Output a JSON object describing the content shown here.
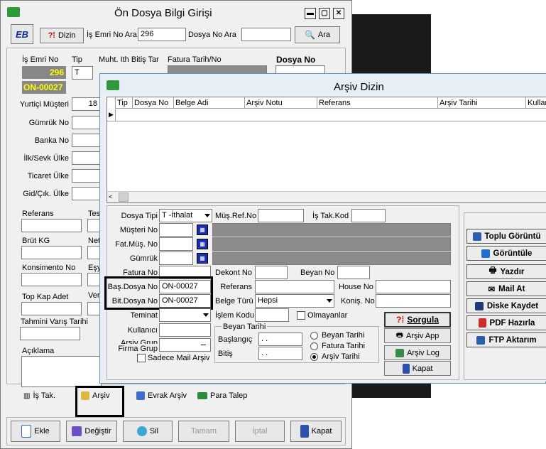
{
  "back_window": {
    "title": "Ön Dosya Bilgi Girişi",
    "dizin_label": "Dizin",
    "is_emri_no_ara_label": "İş Emri No Ara",
    "is_emri_no_ara_value": "296",
    "dosya_no_ara_label": "Dosya No Ara",
    "dosya_no_ara_value": "",
    "ara_label": "Ara",
    "col_is_emri_no": "İş Emri No",
    "col_tip": "Tip",
    "col_muht": "Muht. Ith Bitiş Tar",
    "col_fatura": "Fatura Tarih/No",
    "col_dosya_no": "Dosya No",
    "is_emri_no_value": "296",
    "tip_value": "T",
    "dosya_code": "ON-00027",
    "yurtici_label": "Yurtiçi Müşteri",
    "yurtici_value": "18",
    "gumruk_label": "Gümrük No",
    "banka_label": "Banka No",
    "ilk_sevk_label": "İlk/Sevk Ülke",
    "ticaret_label": "Ticaret Ülke",
    "gid_cik_label": "Gid/Çık. Ülke",
    "referans_label": "Referans",
    "tes_label": "Tes",
    "brut_label": "Brüt KG",
    "net_label": "Net",
    "konsimento_label": "Konsimento No",
    "esya_label": "Eşy",
    "top_kap_label": "Top Kap Adet",
    "ver_label": "Ver",
    "tahmini_label": "Tahmini Varış Tarihi",
    "aciklama_label": "Açıklama",
    "tab_is_tak": "İş Tak.",
    "tab_arsiv": "Arşiv",
    "tab_evrak": "Evrak Arşiv",
    "tab_para": "Para Talep",
    "btn_ekle": "Ekle",
    "btn_degistir": "Değiştir",
    "btn_sil": "Sil",
    "btn_tamam": "Tamam",
    "btn_iptal": "İptal",
    "btn_kapat": "Kapat"
  },
  "front_window": {
    "title": "Arşiv Dizin",
    "grid_columns": [
      "Tip",
      "Dosya No",
      "Belge Adi",
      "Arşiv Notu",
      "Referans",
      "Arşiv Tarihi",
      "Kullan"
    ],
    "dosya_tipi_label": "Dosya Tipi",
    "dosya_tipi_value": "T -İthalat",
    "mus_ref_label": "Müş.Ref.No",
    "is_tak_kod_label": "İş Tak.Kod",
    "musteri_no_label": "Müşteri No",
    "fat_mus_no_label": "Fat.Müş. No",
    "gumruk_label": "Gümrük",
    "fatura_no_label": "Fatura No",
    "dekont_no_label": "Dekont No",
    "beyan_no_label": "Beyan No",
    "bas_dosya_label": "Baş.Dosya No",
    "bas_dosya_value": "ON-00027",
    "bit_dosya_label": "Bit.Dosya No",
    "bit_dosya_value": "ON-00027",
    "referans_label": "Referans",
    "house_no_label": "House No",
    "belge_turu_label": "Belge Türü",
    "belge_turu_value": "Hepsi",
    "konis_no_label": "Koniş. No",
    "teminat_label": "Teminat",
    "islem_kodu_label": "İşlem Kodu",
    "olmayanlar_label": "Olmayanlar",
    "kullanici_label": "Kullanıcı",
    "arsiv_grup_label": "Arşiv Grup",
    "firma_grup_label": "Firma Grup",
    "sadece_mail_label": "Sadece Mail Arşiv",
    "beyan_tarihi_label": "Beyan Tarihi",
    "baslangic_label": "Başlangıç",
    "bitis_label": "Bitiş",
    "date_placeholder": " .  .",
    "radio_beyan": "Beyan Tarihi",
    "radio_fatura": "Fatura Tarihi",
    "radio_arsiv": "Arşiv Tarihi",
    "btn_sorgula": "Sorgula",
    "btn_arsiv_app": "Arşiv App",
    "btn_arsiv_log": "Arşiv Log",
    "btn_kapat": "Kapat",
    "btn_toplu": "Toplu Görüntü",
    "btn_goruntule": "Görüntüle",
    "btn_yazdir": "Yazdır",
    "btn_mail_at": "Mail At",
    "btn_diske": "Diske Kaydet",
    "btn_pdf": "PDF Hazırla",
    "btn_ftp": "FTP Aktarım"
  },
  "colors": {
    "window_bg": "#f0f0f0",
    "yellow_text": "#ffff00",
    "gray_field": "#8c8c8c",
    "highlight_border": "#000000"
  }
}
